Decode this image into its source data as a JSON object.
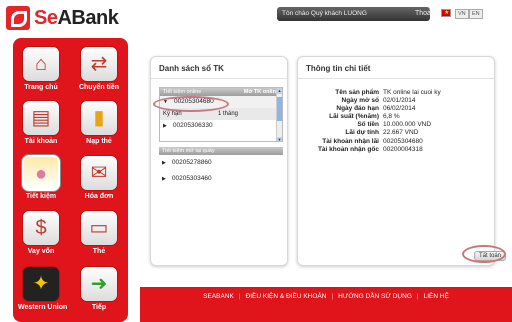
{
  "brand": {
    "name_part1": "Se",
    "name_part2": "ABank"
  },
  "header": {
    "welcome": "Tôn chào Quý khách LUONG",
    "logout": "Thoát",
    "lang_vn": "VN",
    "lang_en": "EN"
  },
  "sidebar": {
    "items": [
      {
        "label": "Trang chủ",
        "icon": "home-icon"
      },
      {
        "label": "Chuyển tiền",
        "icon": "transfer-icon"
      },
      {
        "label": "Tài khoản",
        "icon": "account-icon"
      },
      {
        "label": "Nạp thẻ",
        "icon": "topup-icon"
      },
      {
        "label": "Tiết kiệm",
        "icon": "piggy-bank-icon"
      },
      {
        "label": "Hóa đơn",
        "icon": "bill-icon"
      },
      {
        "label": "Vay vốn",
        "icon": "loan-icon"
      },
      {
        "label": "Thẻ",
        "icon": "card-icon"
      },
      {
        "label": "Western Union",
        "icon": "western-union-icon"
      },
      {
        "label": "Tiếp",
        "icon": "next-arrow-icon"
      }
    ]
  },
  "left_panel": {
    "title": "Danh sách sổ TK",
    "group1": {
      "label": "Tiết kiệm online",
      "action": "Mở TK online"
    },
    "accounts1": [
      "00205304680",
      "00205306330"
    ],
    "term_label": "Kỳ hạn",
    "term_value": "1 tháng",
    "group2": {
      "label": "Tiết kiệm mở tại quầy"
    },
    "accounts2": [
      "00205278860",
      "00205303460"
    ]
  },
  "right_panel": {
    "title": "Thông tin chi tiết",
    "details": [
      {
        "k": "Tên sản phẩm",
        "v": "TK online lai cuoi ky"
      },
      {
        "k": "Ngày mở sổ",
        "v": "02/01/2014"
      },
      {
        "k": "Ngày đáo hạn",
        "v": "06/02/2014"
      },
      {
        "k": "Lãi suất (%năm)",
        "v": "6,8 %"
      },
      {
        "k": "Số tiền",
        "v": "10.000.000  VND"
      },
      {
        "k": "Lãi dự tính",
        "v": "22.667  VND"
      },
      {
        "k": "Tài khoản nhận lãi",
        "v": "00205304680"
      },
      {
        "k": "Tài khoản nhận gốc",
        "v": "00200004318"
      }
    ],
    "close_button": "Tất toán"
  },
  "footer": {
    "links": [
      "SEABANK",
      "ĐIỀU KIỆN & ĐIỀU KHOẢN",
      "HƯỚNG DẪN SỬ DỤNG",
      "LIÊN HỆ"
    ]
  },
  "colors": {
    "brand_red": "#e0141b",
    "highlight_oval": "#c7787c"
  }
}
